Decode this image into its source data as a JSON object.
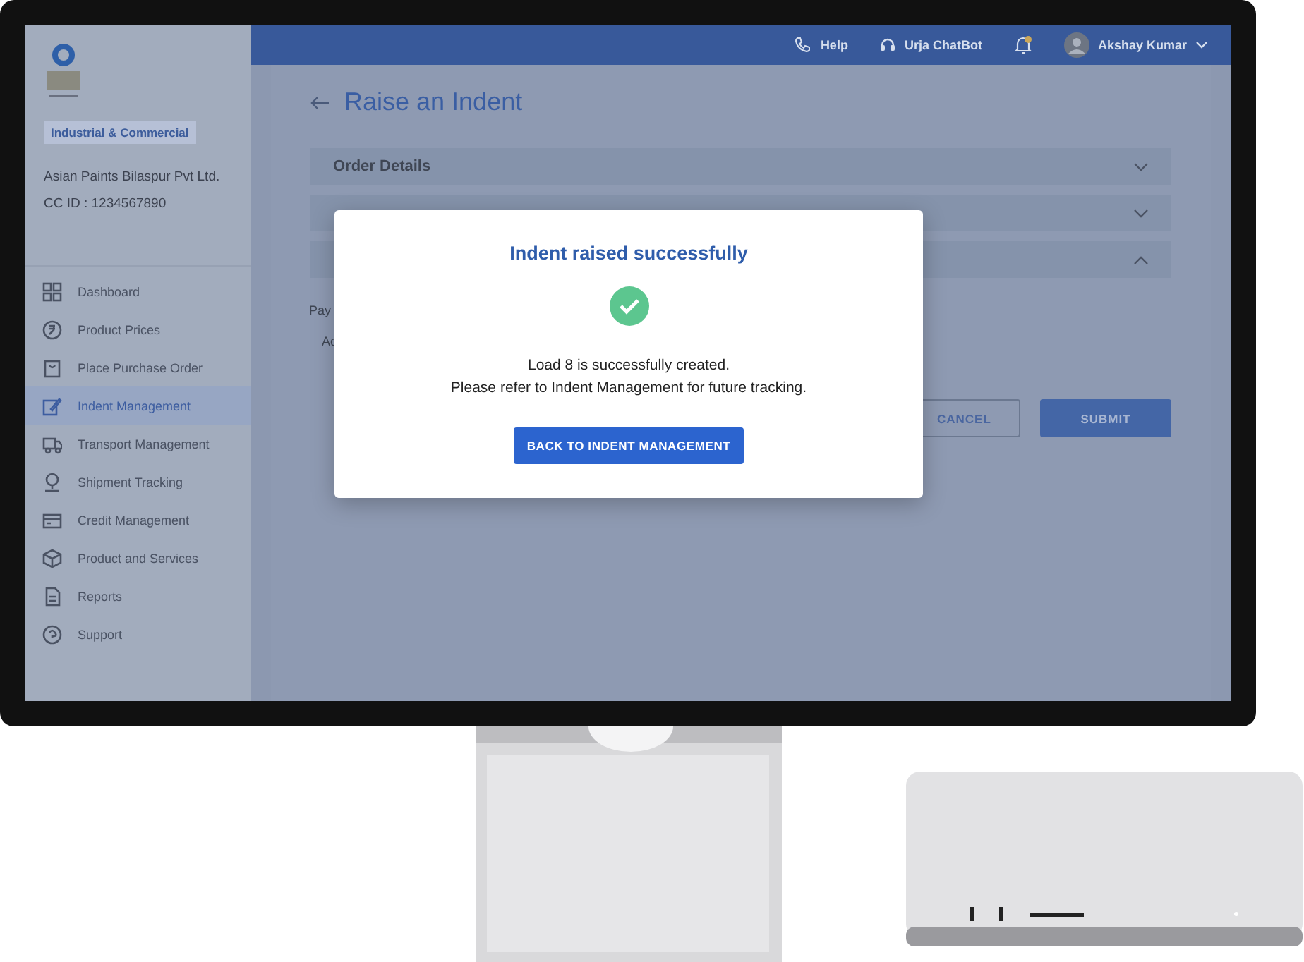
{
  "sidebar": {
    "badge": "Industrial & Commercial",
    "company": "Asian Paints Bilaspur Pvt Ltd.",
    "cc_id": "CC ID : 1234567890",
    "items": [
      {
        "label": "Dashboard",
        "selected": false
      },
      {
        "label": "Product Prices",
        "selected": false
      },
      {
        "label": "Place Purchase Order",
        "selected": false
      },
      {
        "label": "Indent Management",
        "selected": true
      },
      {
        "label": "Transport Management",
        "selected": false
      },
      {
        "label": "Shipment Tracking",
        "selected": false
      },
      {
        "label": "Credit Management",
        "selected": false
      },
      {
        "label": "Product and Services",
        "selected": false
      },
      {
        "label": "Reports",
        "selected": false
      },
      {
        "label": "Support",
        "selected": false
      }
    ]
  },
  "header": {
    "help": "Help",
    "chatbot": "Urja ChatBot",
    "notification": {
      "unread": true
    },
    "user": "Akshay Kumar"
  },
  "page": {
    "title": "Raise an Indent",
    "sections": [
      {
        "title": "Order Details",
        "expanded": false
      },
      {
        "expanded": false
      },
      {
        "expanded": true
      }
    ],
    "field_label": "Pay",
    "field_value": "Ac",
    "cancel": "CANCEL",
    "submit": "SUBMIT"
  },
  "modal": {
    "title": "Indent raised successfully",
    "line_1": "Load 8 is successfully created.",
    "line_2": "Please refer to Indent Management for future tracking.",
    "button": "BACK TO INDENT MANAGEMENT"
  }
}
